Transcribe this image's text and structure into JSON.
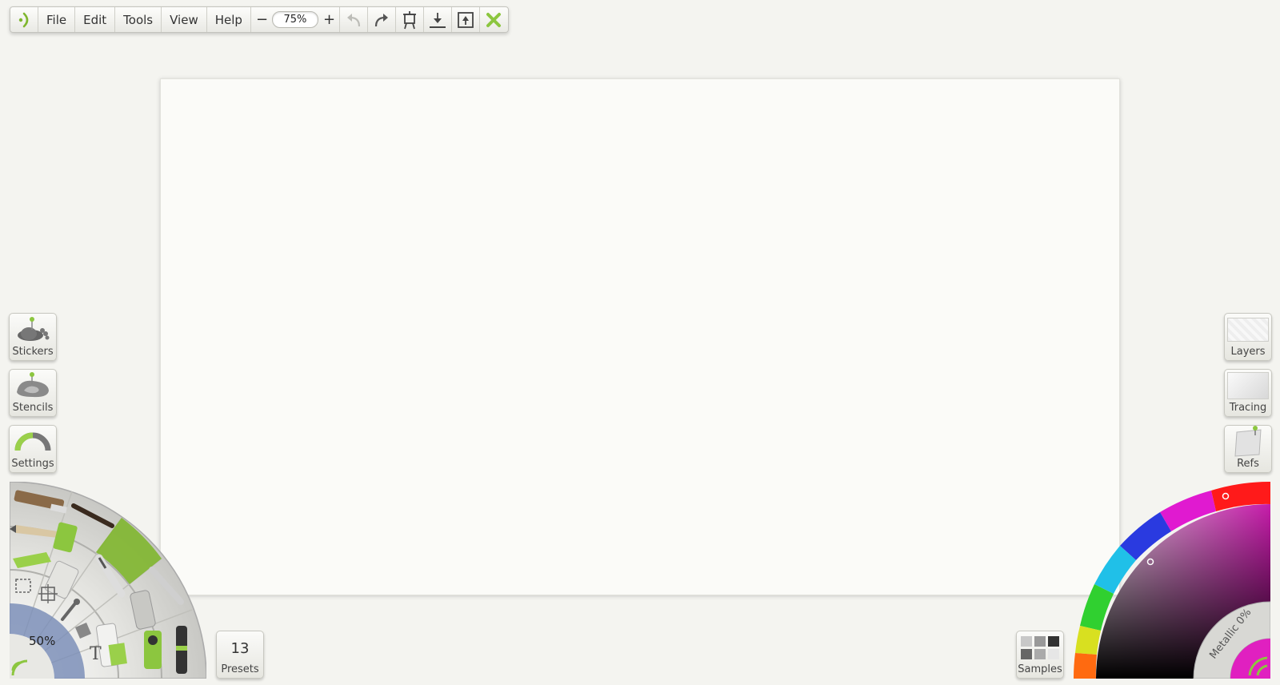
{
  "menu": {
    "file": "File",
    "edit": "Edit",
    "tools": "Tools",
    "view": "View",
    "help": "Help"
  },
  "zoom": {
    "minus": "−",
    "value": "75%",
    "plus": "+"
  },
  "left_panel": {
    "stickers": "Stickers",
    "stencils": "Stencils",
    "settings": "Settings"
  },
  "right_panel": {
    "layers": "Layers",
    "tracing": "Tracing",
    "refs": "Refs"
  },
  "brush": {
    "size": "50%",
    "text_tool": "T"
  },
  "presets": {
    "count": "13",
    "label": "Presets"
  },
  "samples": {
    "label": "Samples"
  },
  "color": {
    "metallic": "Metallic 0%",
    "accent": "#8cc63f",
    "current": "#e020c0"
  }
}
